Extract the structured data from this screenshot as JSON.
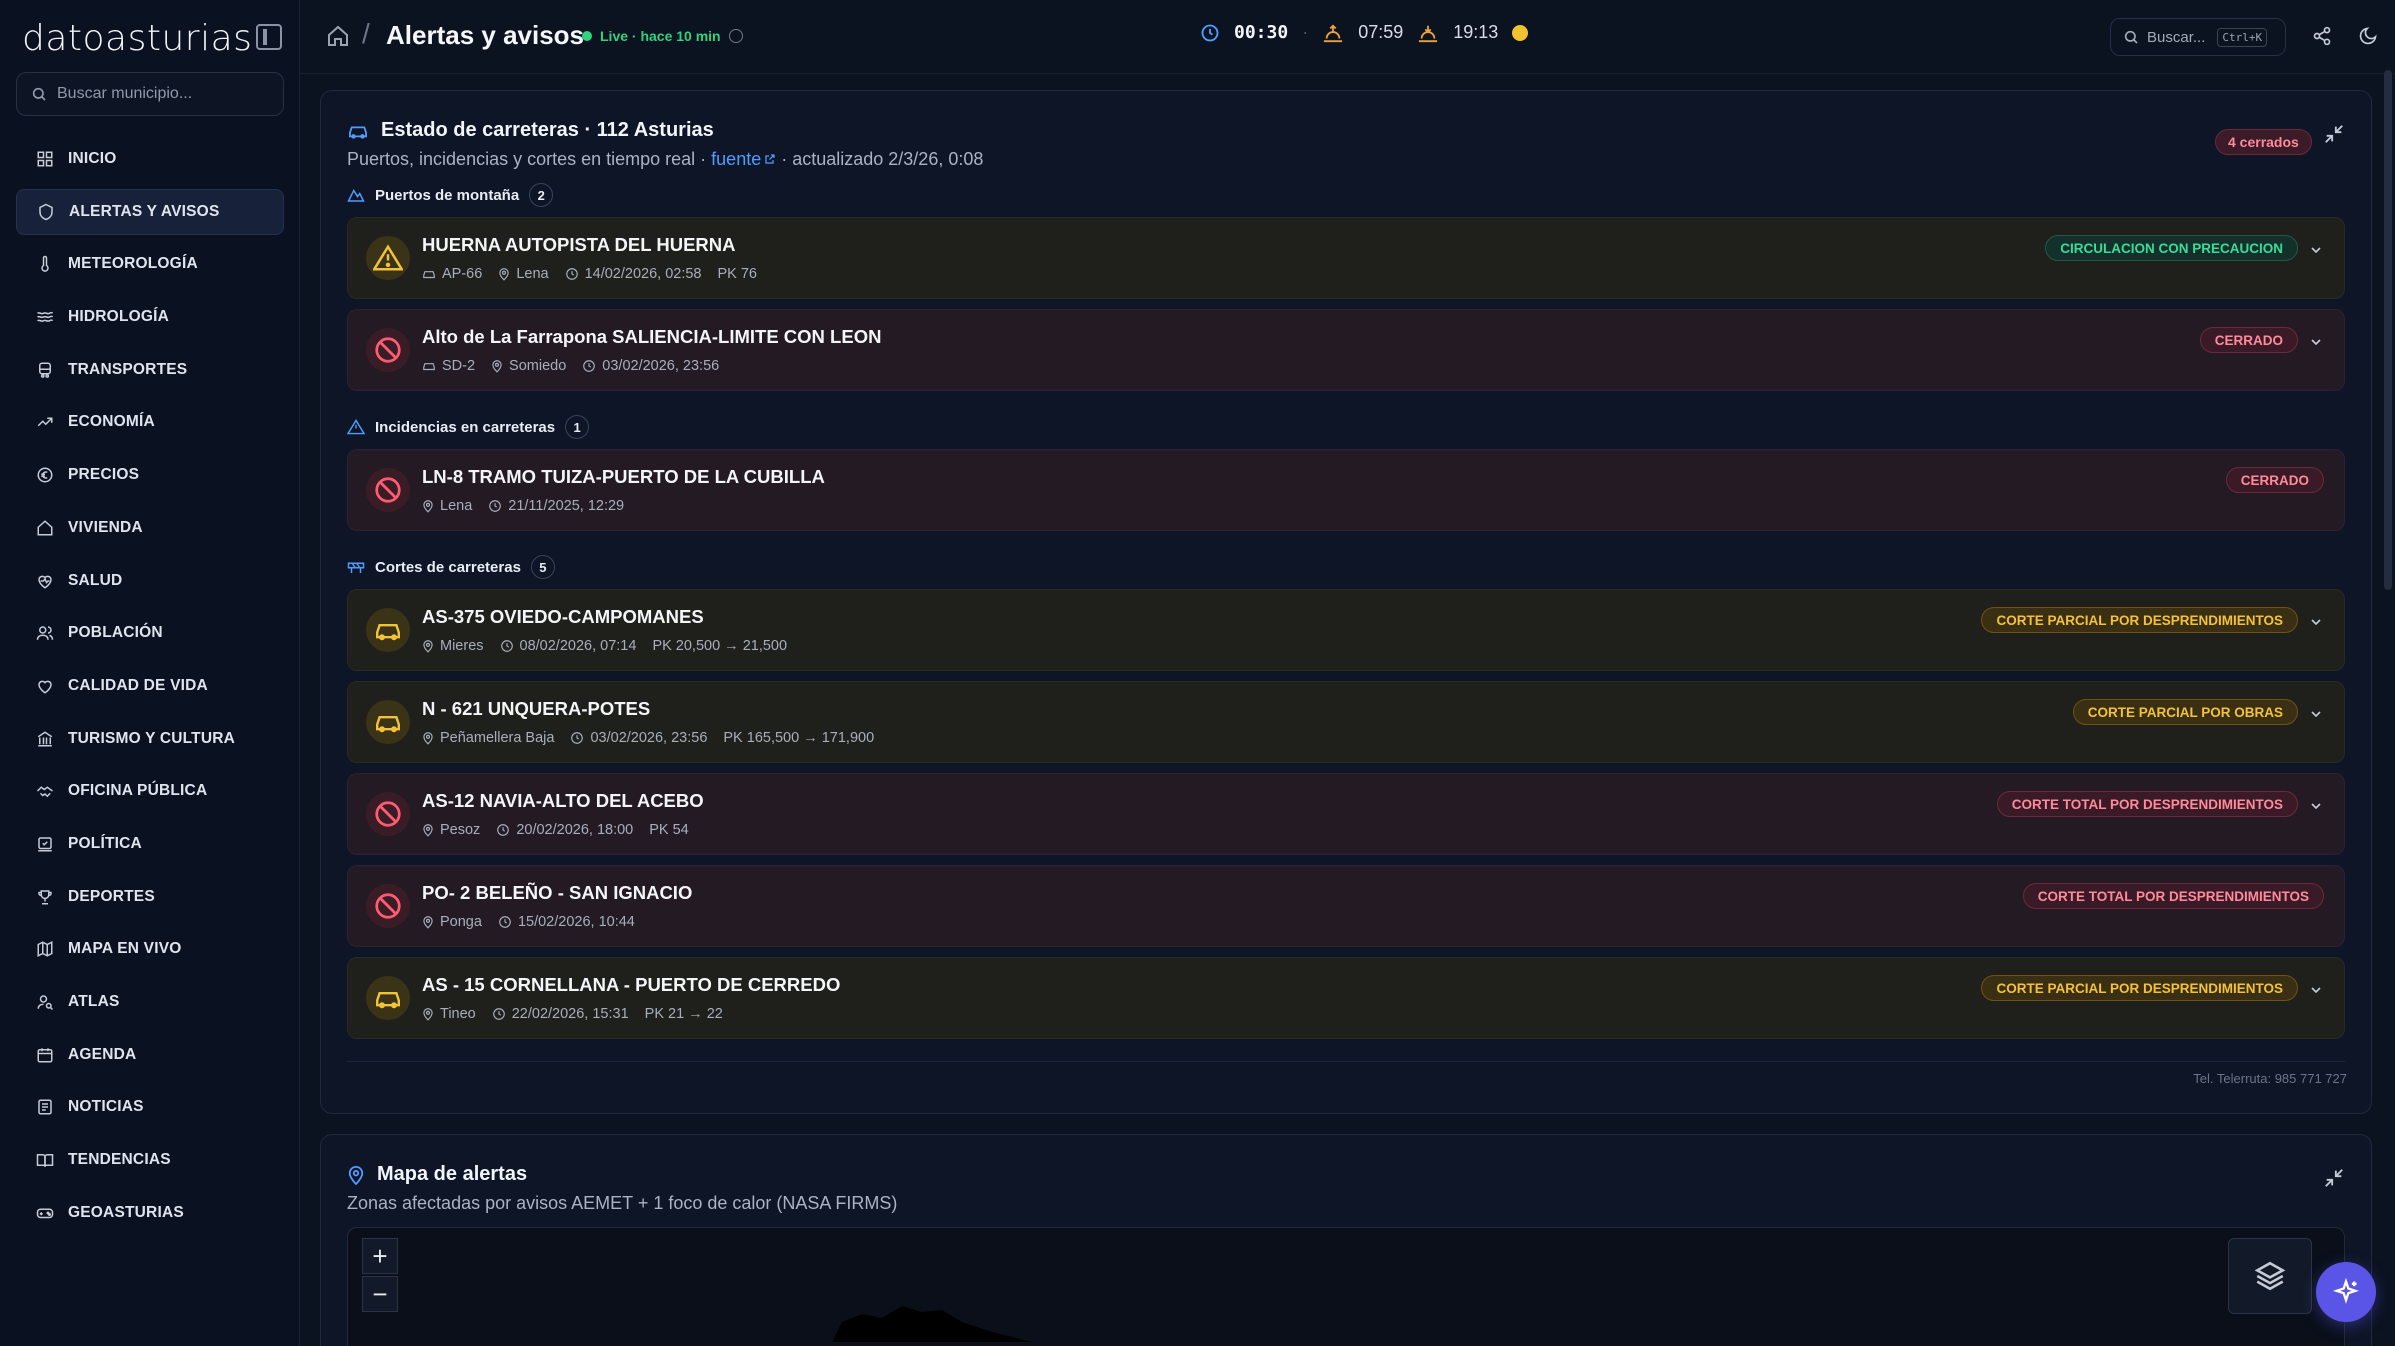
{
  "brand": {
    "name": "datoasturias"
  },
  "search": {
    "placeholder": "Buscar municipio..."
  },
  "sidebar": {
    "items": [
      {
        "label": "INICIO",
        "icon": "grid-icon"
      },
      {
        "label": "ALERTAS Y AVISOS",
        "icon": "shield-icon",
        "active": true
      },
      {
        "label": "METEOROLOGÍA",
        "icon": "thermometer-icon"
      },
      {
        "label": "HIDROLOGÍA",
        "icon": "waves-icon"
      },
      {
        "label": "TRANSPORTES",
        "icon": "bus-icon"
      },
      {
        "label": "ECONOMÍA",
        "icon": "trending-icon"
      },
      {
        "label": "PRECIOS",
        "icon": "euro-icon"
      },
      {
        "label": "VIVIENDA",
        "icon": "house-icon"
      },
      {
        "label": "SALUD",
        "icon": "heart-pulse-icon"
      },
      {
        "label": "POBLACIÓN",
        "icon": "users-icon"
      },
      {
        "label": "CALIDAD DE VIDA",
        "icon": "heart-icon"
      },
      {
        "label": "TURISMO Y CULTURA",
        "icon": "landmark-icon"
      },
      {
        "label": "OFICINA PÚBLICA",
        "icon": "handshake-icon"
      },
      {
        "label": "POLÍTICA",
        "icon": "vote-icon"
      },
      {
        "label": "DEPORTES",
        "icon": "trophy-icon"
      },
      {
        "label": "MAPA EN VIVO",
        "icon": "map-icon"
      },
      {
        "label": "ATLAS",
        "icon": "user-search-icon"
      },
      {
        "label": "AGENDA",
        "icon": "calendar-icon"
      },
      {
        "label": "NOTICIAS",
        "icon": "newspaper-icon"
      },
      {
        "label": "TENDENCIAS",
        "icon": "book-icon"
      },
      {
        "label": "GEOASTURIAS",
        "icon": "gamepad-icon"
      }
    ]
  },
  "header": {
    "title": "Alertas y avisos",
    "live_text": "Live · hace 10 min",
    "clock": "00:30",
    "sunrise": "07:59",
    "sunset": "19:13",
    "search_label": "Buscar...",
    "shortcut": "Ctrl+K"
  },
  "roads": {
    "title": "Estado de carreteras · 112 Asturias",
    "subtitle_prefix": "Puertos, incidencias y cortes en tiempo real · ",
    "source_link": "fuente",
    "subtitle_suffix": " · actualizado 2/3/26, 0:08",
    "closed_badge": "4 cerrados",
    "groups": [
      {
        "title": "Puertos de montaña",
        "count": "2"
      },
      {
        "title": "Incidencias en carreteras",
        "count": "1"
      },
      {
        "title": "Cortes de carreteras",
        "count": "5"
      }
    ],
    "cards": [
      {
        "title": "HUERNA AUTOPISTA DEL HUERNA",
        "road": "AP-66",
        "place": "Lena",
        "date": "14/02/2026, 02:58",
        "pk": "PK 76",
        "status": "CIRCULACION CON PRECAUCION"
      },
      {
        "title": "Alto de La Farrapona SALIENCIA-LIMITE CON LEON",
        "road": "SD-2",
        "place": "Somiedo",
        "date": "03/02/2026, 23:56",
        "pk": "",
        "status": "CERRADO"
      },
      {
        "title": "LN-8 TRAMO TUIZA-PUERTO DE LA CUBILLA",
        "road": "",
        "place": "Lena",
        "date": "21/11/2025, 12:29",
        "pk": "",
        "status": "CERRADO"
      },
      {
        "title": "AS-375 OVIEDO-CAMPOMANES",
        "road": "",
        "place": "Mieres",
        "date": "08/02/2026, 07:14",
        "pk": "PK 20,500 → 21,500",
        "status": "CORTE PARCIAL POR DESPRENDIMIENTOS"
      },
      {
        "title": "N - 621 UNQUERA-POTES",
        "road": "",
        "place": "Peñamellera Baja",
        "date": "03/02/2026, 23:56",
        "pk": "PK 165,500 → 171,900",
        "status": "CORTE PARCIAL POR OBRAS"
      },
      {
        "title": "AS-12 NAVIA-ALTO DEL ACEBO",
        "road": "",
        "place": "Pesoz",
        "date": "20/02/2026, 18:00",
        "pk": "PK 54",
        "status": "CORTE TOTAL POR DESPRENDIMIENTOS"
      },
      {
        "title": "PO- 2 BELEÑO - SAN IGNACIO",
        "road": "",
        "place": "Ponga",
        "date": "15/02/2026, 10:44",
        "pk": "",
        "status": "CORTE TOTAL POR DESPRENDIMIENTOS"
      },
      {
        "title": "AS - 15 CORNELLANA - PUERTO DE CERREDO",
        "road": "",
        "place": "Tineo",
        "date": "22/02/2026, 15:31",
        "pk": "PK 21 → 22",
        "status": "CORTE PARCIAL POR DESPRENDIMIENTOS"
      }
    ],
    "footer": "Tel. Telerruta: 985 771 727"
  },
  "map": {
    "title": "Mapa de alertas",
    "subtitle": "Zonas afectadas por avisos AEMET + 1 foco de calor (NASA FIRMS)",
    "zoom_in": "+",
    "zoom_out": "−"
  },
  "colors": {
    "green": "#3bdc99",
    "red": "#ff8a9c",
    "amber": "#f3c23b",
    "accent": "#5a55e6"
  }
}
